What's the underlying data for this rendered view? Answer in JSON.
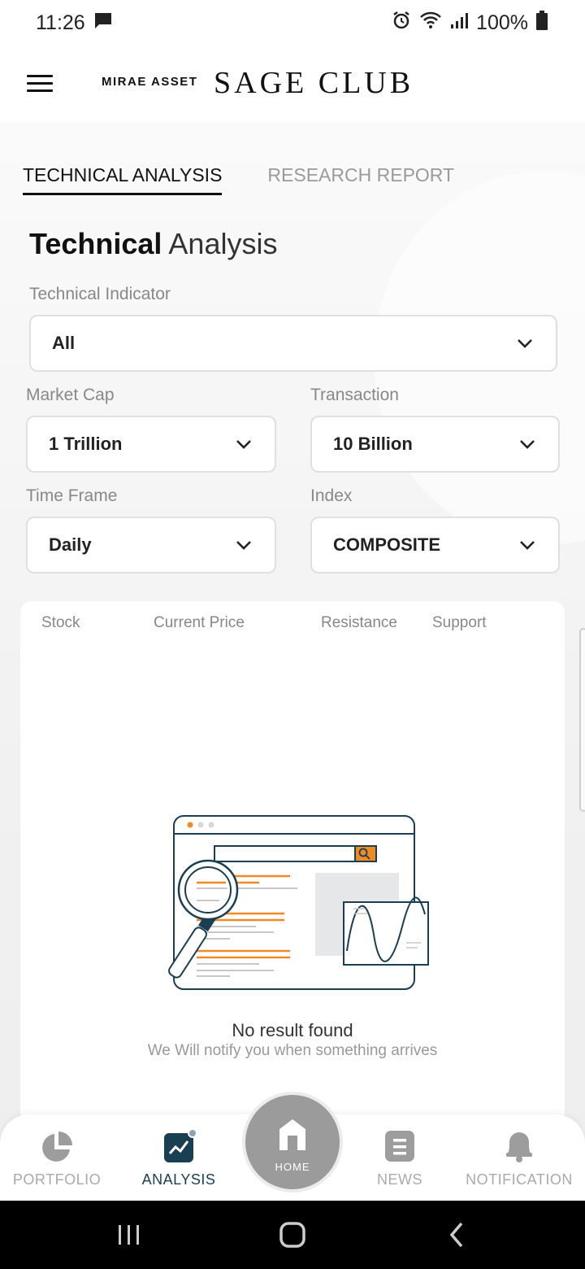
{
  "status_bar": {
    "time": "11:26",
    "battery": "100%",
    "icons": [
      "message-icon",
      "alarm-icon",
      "wifi-icon",
      "signal-icon",
      "battery-icon"
    ]
  },
  "header": {
    "brand_small": "MIRAE ASSET",
    "brand_large": "SAGE CLUB"
  },
  "tabs": [
    {
      "label": "TECHNICAL ANALYSIS",
      "active": true
    },
    {
      "label": "RESEARCH REPORT",
      "active": false
    }
  ],
  "title": {
    "bold": "Technical",
    "light": "Analysis"
  },
  "filters": {
    "technical_indicator": {
      "label": "Technical Indicator",
      "value": "All"
    },
    "market_cap": {
      "label": "Market Cap",
      "value": "1 Trillion"
    },
    "transaction": {
      "label": "Transaction",
      "value": "10 Billion"
    },
    "time_frame": {
      "label": "Time Frame",
      "value": "Daily"
    },
    "index": {
      "label": "Index",
      "value": "COMPOSITE"
    }
  },
  "table": {
    "columns": [
      "Stock",
      "Current Price",
      "Resistance",
      "Support"
    ],
    "rows": []
  },
  "empty_state": {
    "title": "No result found",
    "subtitle": "We Will notify you when something arrives"
  },
  "bottom_nav": {
    "items": [
      {
        "label": "PORTFOLIO",
        "icon": "pie-chart-icon",
        "active": false
      },
      {
        "label": "ANALYSIS",
        "icon": "trend-chart-icon",
        "active": true
      },
      {
        "label": "HOME",
        "icon": "home-icon",
        "active": false
      },
      {
        "label": "NEWS",
        "icon": "news-icon",
        "active": false
      },
      {
        "label": "NOTIFICATION",
        "icon": "bell-icon",
        "active": false
      }
    ]
  },
  "colors": {
    "accent_orange": "#f08a24",
    "navy": "#1a3e52",
    "home_fab": "#9b9b9b"
  }
}
